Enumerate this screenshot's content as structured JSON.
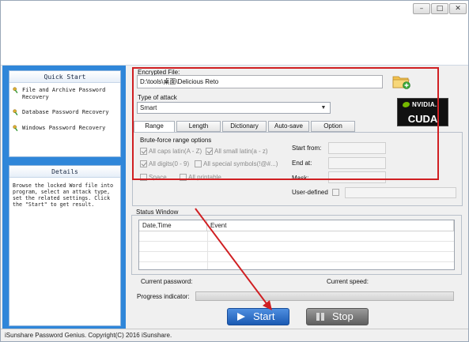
{
  "window": {
    "minimize_glyph": "–",
    "maximize_glyph": "□",
    "close_glyph": "✕"
  },
  "sidebar": {
    "quick_start_title": "Quick Start",
    "items": [
      {
        "label": "File and Archive Password Recovery",
        "icon": "key-icon"
      },
      {
        "label": "Database Password Recovery",
        "icon": "key-icon"
      },
      {
        "label": "Windows Password Recovery",
        "icon": "key-icon"
      }
    ],
    "details_title": "Details",
    "details_text": "Browse the locked Word file into program, select an attack type, set the related settings. Click the \"Start\" to get result."
  },
  "encrypted_file": {
    "label": "Encrypted File:",
    "value": "D:\\tools\\桌面\\Delicious Reto"
  },
  "attack": {
    "label": "Type of attack",
    "selected": "Smart"
  },
  "nvidia_badge": {
    "brand": "NVIDIA.",
    "product": "CUDA"
  },
  "tabs": [
    "Range",
    "Length",
    "Dictionary",
    "Auto-save",
    "Option"
  ],
  "range": {
    "group_title": "Brute-force range options",
    "options": [
      {
        "label": "All caps latin(A - Z)",
        "checked": true
      },
      {
        "label": "All small latin(a - z)",
        "checked": true
      },
      {
        "label": "All digits(0 - 9)",
        "checked": true
      },
      {
        "label": "All special symbols(!@#...)",
        "checked": false
      },
      {
        "label": "Space",
        "checked": false
      },
      {
        "label": "All printable",
        "checked": false
      }
    ],
    "start_from_label": "Start from:",
    "end_at_label": "End at:",
    "mask_label": "Mask:",
    "user_defined_label": "User-defined"
  },
  "status_window": {
    "title": "Status Window",
    "col_datetime": "Date,Time",
    "col_event": "Event"
  },
  "current_password_label": "Current password:",
  "current_speed_label": "Current speed:",
  "progress": {
    "label": "Progress indicator:",
    "fraction": 0
  },
  "buttons": {
    "start": "Start",
    "stop": "Stop"
  },
  "statusbar_text": "iSunshare Password Genius. Copyright(C) 2016 iSunshare.",
  "colors": {
    "sidebar_blue": "#2f86d9",
    "annotation_red": "#d01f22",
    "start_blue": "#1b5ab3",
    "stop_gray": "#5f5f5f"
  }
}
